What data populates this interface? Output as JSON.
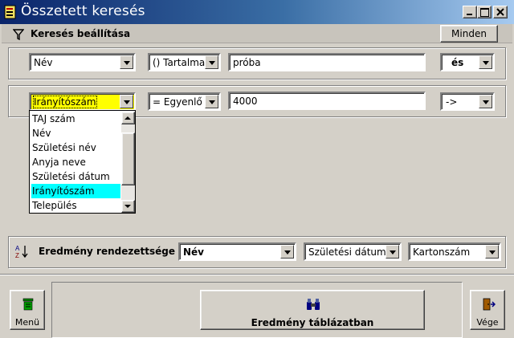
{
  "window": {
    "title": "Összetett keresés",
    "controls": [
      "minimize-icon",
      "maximize-icon",
      "close-icon"
    ]
  },
  "header": {
    "label": "Keresés beállítása",
    "all_button": "Minden"
  },
  "row1": {
    "field": "Név",
    "operator": "() Tartalmaz",
    "value": "próba",
    "connector": "és"
  },
  "row2": {
    "field": "Irányítószám",
    "operator": "= Egyenlő",
    "value": "4000",
    "connector": "->"
  },
  "dropdown_list": {
    "items": [
      "TAJ szám",
      "Név",
      "Születési név",
      "Anyja neve",
      "Születési dátum",
      "Irányítószám",
      "Település"
    ],
    "selected": "Irányítószám"
  },
  "sort": {
    "label": "Eredmény rendezettsége",
    "sort1": "Név",
    "sort2": "Születési dátum",
    "sort3": "Kartonszám"
  },
  "footer": {
    "menu_label": "Menü",
    "result_button": "Eredmény táblázatban",
    "exit_label": "Vége"
  },
  "colors": {
    "title_bar": "#0a246a",
    "selected_field": "#ffff00",
    "list_highlight": "#00ffff"
  }
}
